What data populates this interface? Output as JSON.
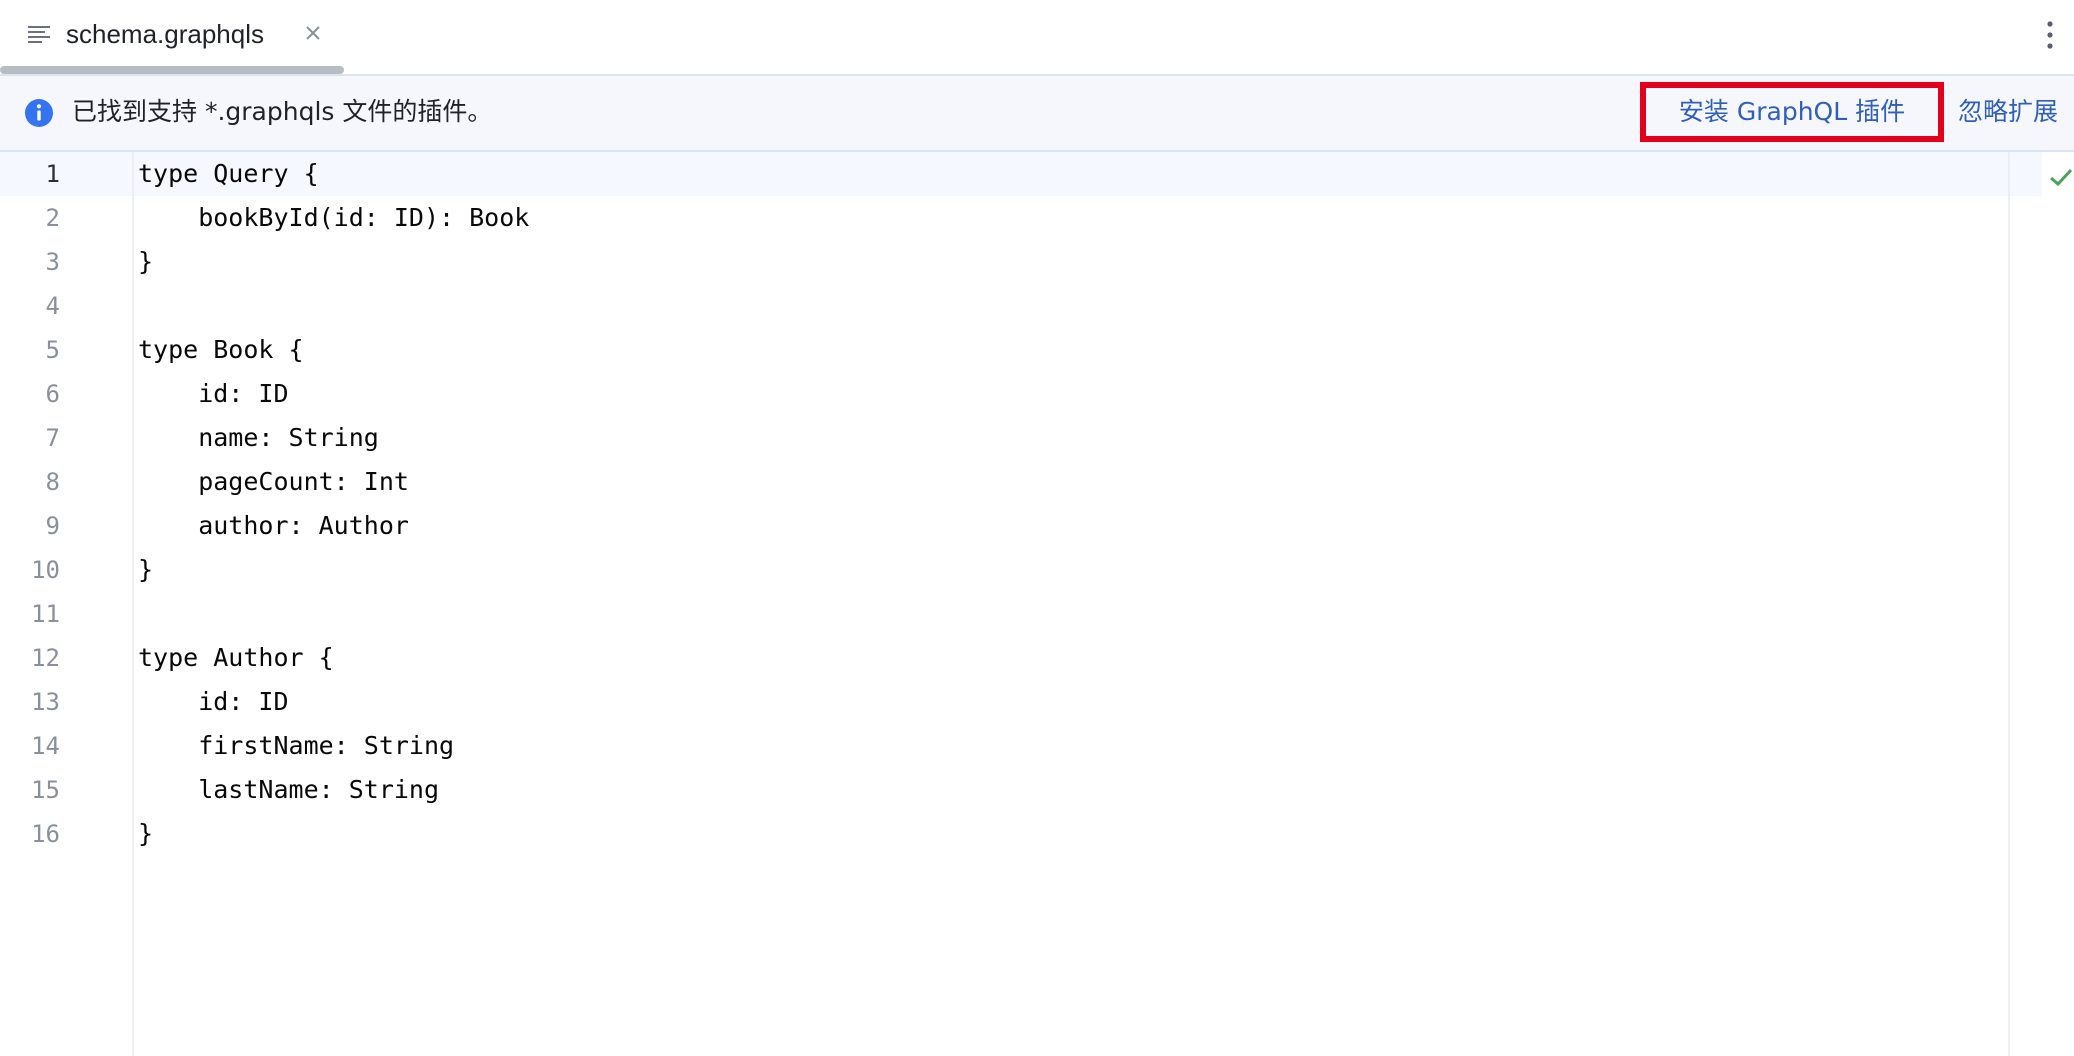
{
  "tab": {
    "filename": "schema.graphqls",
    "file_icon": "text-lines-icon",
    "close_icon": "close-icon"
  },
  "toolbar": {
    "more_icon": "vertical-ellipsis-icon"
  },
  "banner": {
    "icon": "info-icon",
    "message": "已找到支持 *.graphqls 文件的插件。",
    "install_label": "安装 GraphQL 插件",
    "ignore_label": "忽略扩展",
    "highlight_color": "#e3001b",
    "link_color": "#2f5fb8"
  },
  "editor": {
    "status_icon": "checkmark-icon",
    "status_color": "#4aa35a",
    "current_line": 1,
    "lines": [
      {
        "number": "1",
        "code": "type Query {"
      },
      {
        "number": "2",
        "code": "    bookById(id: ID): Book"
      },
      {
        "number": "3",
        "code": "}"
      },
      {
        "number": "4",
        "code": ""
      },
      {
        "number": "5",
        "code": "type Book {"
      },
      {
        "number": "6",
        "code": "    id: ID"
      },
      {
        "number": "7",
        "code": "    name: String"
      },
      {
        "number": "8",
        "code": "    pageCount: Int"
      },
      {
        "number": "9",
        "code": "    author: Author"
      },
      {
        "number": "10",
        "code": "}"
      },
      {
        "number": "11",
        "code": ""
      },
      {
        "number": "12",
        "code": "type Author {"
      },
      {
        "number": "13",
        "code": "    id: ID"
      },
      {
        "number": "14",
        "code": "    firstName: String"
      },
      {
        "number": "15",
        "code": "    lastName: String"
      },
      {
        "number": "16",
        "code": "}"
      }
    ]
  }
}
